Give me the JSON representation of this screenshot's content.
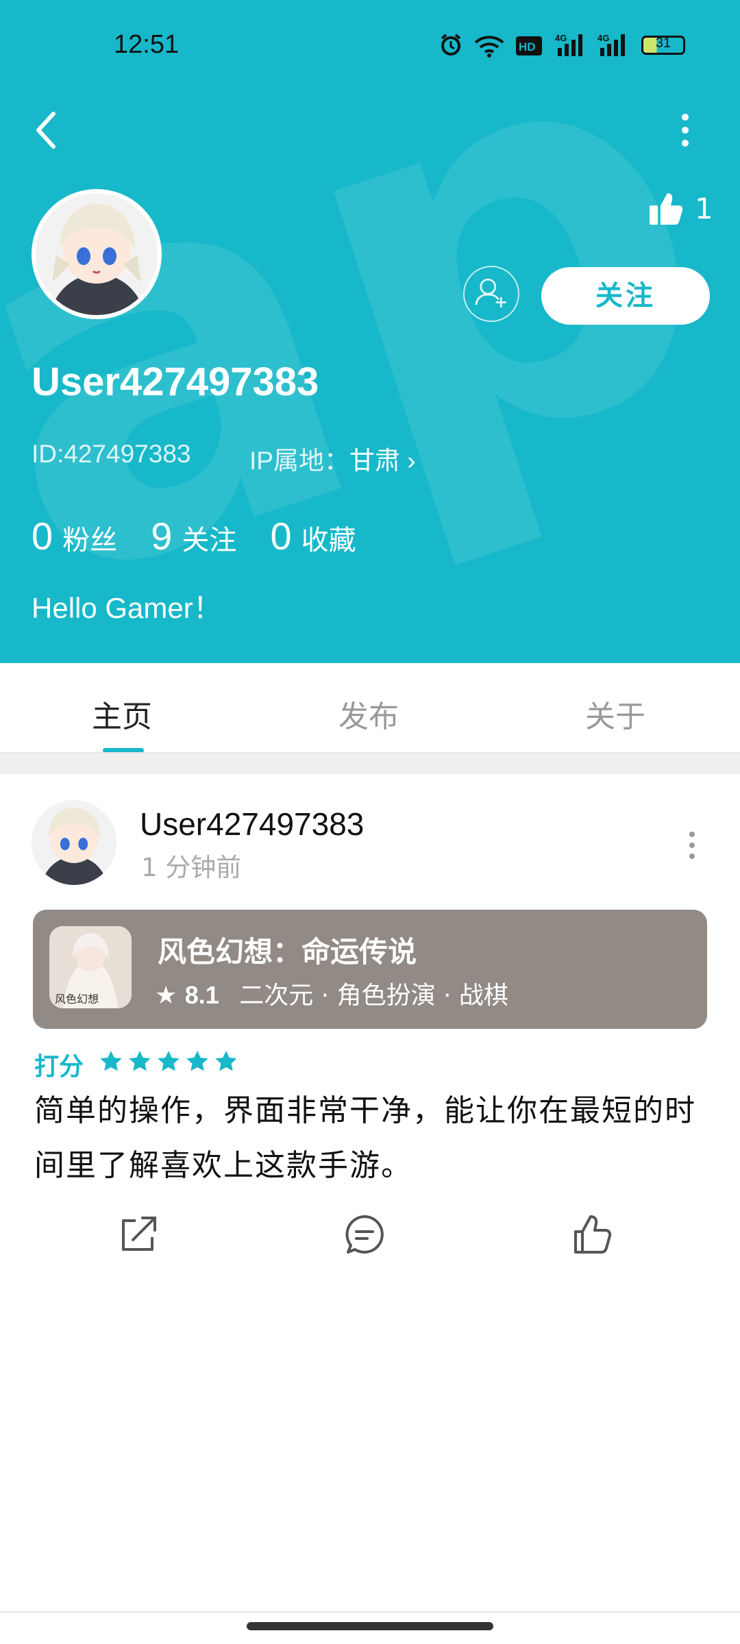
{
  "status_bar": {
    "time": "12:51",
    "battery": "31"
  },
  "profile": {
    "username": "User427497383",
    "id_text": "ID:427497383",
    "ip_label": "IP属地：",
    "ip_value": "甘肃",
    "likes": "1",
    "follow_label": "关注",
    "stats": [
      {
        "value": "0",
        "label": "粉丝"
      },
      {
        "value": "9",
        "label": "关注"
      },
      {
        "value": "0",
        "label": "收藏"
      }
    ],
    "bio": "Hello Gamer！"
  },
  "tabs": [
    {
      "label": "主页",
      "active": true
    },
    {
      "label": "发布",
      "active": false
    },
    {
      "label": "关于",
      "active": false
    }
  ],
  "post": {
    "author": "User427497383",
    "time": "1 分钟前",
    "game": {
      "title": "风色幻想：命运传说",
      "rating": "8.1",
      "tags": "二次元 · 角色扮演 · 战棋",
      "icon_text": "风色幻想"
    },
    "rating_label": "打分",
    "stars": 5,
    "review": "简单的操作，界面非常干净，能让你在最短的时间里了解喜欢上这款手游。"
  },
  "colors": {
    "accent": "#17b8c9",
    "card": "#918a85"
  },
  "icons": [
    "back-icon",
    "more-icon",
    "thumbs-up-icon",
    "add-friend-icon",
    "share-icon",
    "comment-icon",
    "like-icon",
    "star-icon"
  ]
}
